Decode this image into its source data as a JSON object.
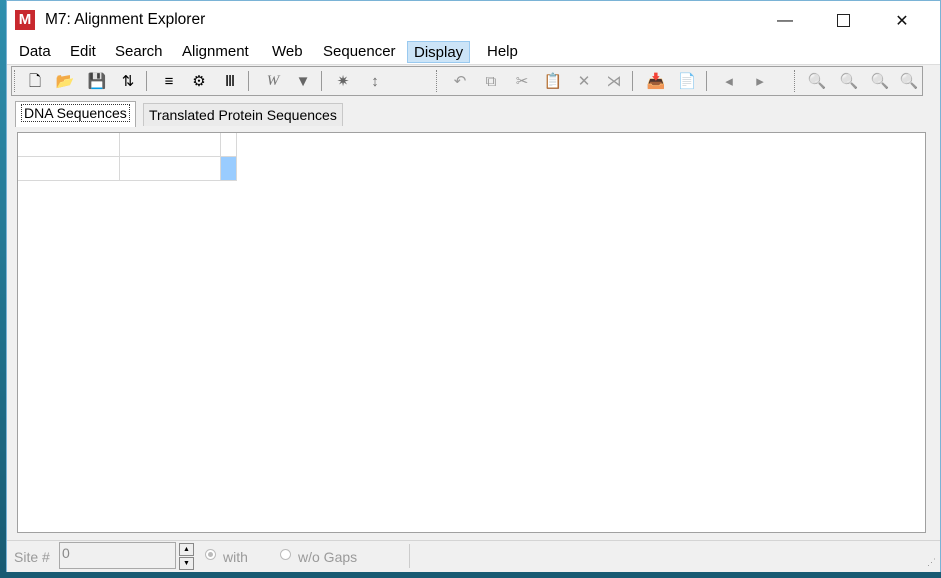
{
  "window": {
    "icon_letter": "M",
    "title": "M7: Alignment Explorer",
    "minimize_glyph": "—",
    "close_glyph": "✕"
  },
  "menu": {
    "items": [
      "Data",
      "Edit",
      "Search",
      "Alignment",
      "Web",
      "Sequencer",
      "Display",
      "Help"
    ],
    "active": "Display"
  },
  "toolbar": {
    "buttons": [
      {
        "name": "new-icon",
        "glyph": "🗋"
      },
      {
        "name": "open-folder-icon",
        "glyph": "📂"
      },
      {
        "name": "save-icon",
        "glyph": "💾"
      },
      {
        "name": "translate-icon",
        "glyph": "⇅"
      },
      {
        "name": "clustalw-icon",
        "glyph": "≡"
      },
      {
        "name": "muscle-icon",
        "glyph": "⚙"
      },
      {
        "name": "sequencer-icon",
        "glyph": "Ⅲ"
      },
      {
        "name": "web-icon",
        "glyph": "W"
      },
      {
        "name": "web-down-icon",
        "glyph": "▼"
      },
      {
        "name": "explode-icon",
        "glyph": "✷"
      },
      {
        "name": "insert-gap-icon",
        "glyph": "↕"
      },
      {
        "name": "undo-icon",
        "glyph": "↶"
      },
      {
        "name": "copy-icon",
        "glyph": "⧉"
      },
      {
        "name": "cut-icon",
        "glyph": "✂"
      },
      {
        "name": "paste-icon",
        "glyph": "📋"
      },
      {
        "name": "delete-icon",
        "glyph": "✕"
      },
      {
        "name": "delete-gap-icon",
        "glyph": "⋊"
      },
      {
        "name": "add-sequence-icon",
        "glyph": "📥"
      },
      {
        "name": "add-sequence-file-icon",
        "glyph": "📄"
      },
      {
        "name": "move-left-icon",
        "glyph": "◂"
      },
      {
        "name": "move-right-icon",
        "glyph": "▸"
      },
      {
        "name": "find-icon",
        "glyph": "🔍"
      },
      {
        "name": "find-previous-icon",
        "glyph": "🔍"
      },
      {
        "name": "find-next-icon",
        "glyph": "🔍"
      },
      {
        "name": "find-motif-icon",
        "glyph": "🔍"
      }
    ]
  },
  "tabs": [
    {
      "label": "DNA Sequences",
      "selected": true
    },
    {
      "label": "Translated Protein Sequences",
      "selected": false
    }
  ],
  "status": {
    "site_label": "Site #",
    "site_value": "0",
    "with_label": "with",
    "without_label": "w/o Gaps"
  },
  "colors": {
    "selection_cell": "#99ccff",
    "app_icon": "#c8282e",
    "active_menu": "#cce4f7"
  }
}
